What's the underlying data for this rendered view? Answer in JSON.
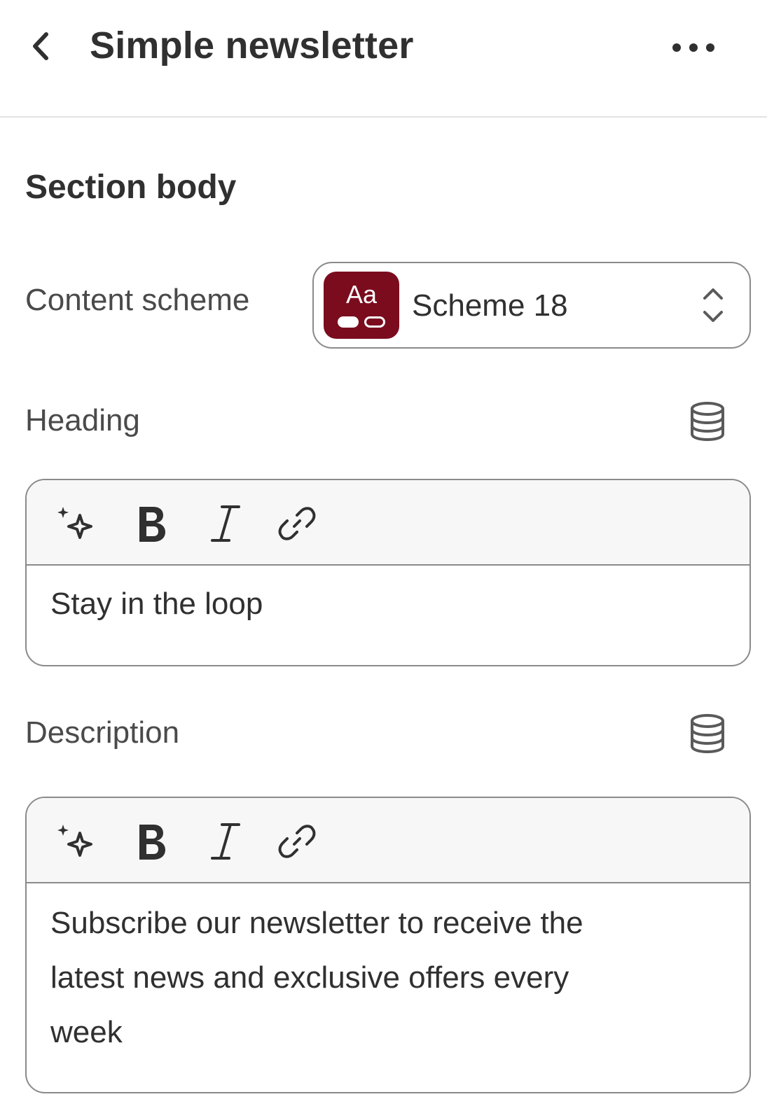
{
  "header": {
    "title": "Simple newsletter",
    "back_icon": "chevron-left-icon",
    "more_icon": "more-horizontal-icon"
  },
  "section": {
    "title": "Section body"
  },
  "content_scheme": {
    "label": "Content scheme",
    "value": "Scheme 18",
    "swatch_text": "Aa",
    "swatch_color": "#7a0c1e"
  },
  "heading_field": {
    "label": "Heading",
    "value": "Stay in the loop",
    "dynamic_source_icon": "database-icon"
  },
  "description_field": {
    "label": "Description",
    "lines": [
      "Subscribe our newsletter to receive the",
      "latest news and exclusive offers every",
      "week"
    ],
    "dynamic_source_icon": "database-icon"
  },
  "toolbar": {
    "buttons": [
      "sparkle-ai-icon",
      "bold-icon",
      "italic-icon",
      "link-icon"
    ]
  }
}
